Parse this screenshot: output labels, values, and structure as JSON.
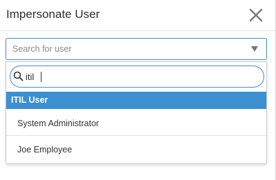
{
  "dialog": {
    "title": "Impersonate User",
    "close_icon": "close-icon"
  },
  "user_select": {
    "placeholder": "Search for user"
  },
  "search": {
    "value": "itil",
    "icon": "search-icon"
  },
  "options": [
    {
      "label": "ITIL User",
      "highlighted": true
    },
    {
      "label": "System Administrator",
      "highlighted": false
    },
    {
      "label": "Joe Employee",
      "highlighted": false
    }
  ],
  "colors": {
    "accent": "#3c8fd0",
    "focus_border": "#3b8ec9"
  }
}
